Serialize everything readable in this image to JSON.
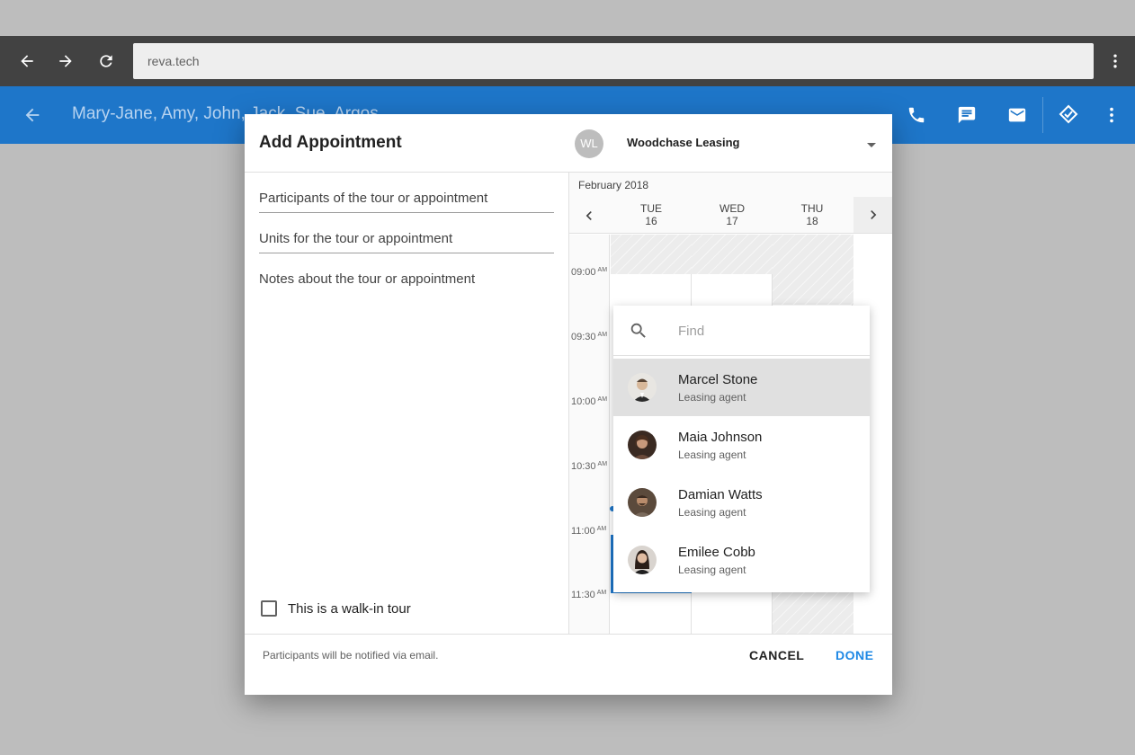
{
  "browser": {
    "url": "reva.tech",
    "icons": [
      "arrow-back-icon",
      "arrow-forward-icon",
      "reload-icon",
      "more-vert-icon"
    ]
  },
  "appbar": {
    "title": "Mary-Jane, Amy, John, Jack, Sue, Argos",
    "icons": [
      "arrow-back-icon",
      "phone-icon",
      "chat-icon",
      "email-icon",
      "flag-icon",
      "more-vert-icon"
    ]
  },
  "dialog": {
    "title": "Add Appointment",
    "owner_initials": "WL",
    "owner_name": "Woodchase Leasing",
    "participants_placeholder": "Participants of the tour or appointment",
    "units_placeholder": "Units for the tour or appointment",
    "notes_placeholder": "Notes about the tour or appointment",
    "walkin_label": "This is a walk-in tour",
    "walkin_checked": false,
    "footnote": "Participants will be notified via email.",
    "cancel_label": "CANCEL",
    "done_label": "DONE"
  },
  "calendar": {
    "month": "February 2018",
    "days": [
      {
        "dow": "TUE",
        "date": "16"
      },
      {
        "dow": "WED",
        "date": "17"
      },
      {
        "dow": "THU",
        "date": "18"
      }
    ],
    "times": [
      {
        "time": "09:00",
        "ampm": "AM"
      },
      {
        "time": "09:30",
        "ampm": "AM"
      },
      {
        "time": "10:00",
        "ampm": "AM"
      },
      {
        "time": "10:30",
        "ampm": "AM"
      },
      {
        "time": "11:00",
        "ampm": "AM"
      },
      {
        "time": "11:30",
        "ampm": "AM"
      }
    ]
  },
  "dropdown": {
    "search_placeholder": "Find",
    "agents": [
      {
        "name": "Marcel Stone",
        "role": "Leasing agent",
        "selected": true
      },
      {
        "name": "Maia Johnson",
        "role": "Leasing agent",
        "selected": false
      },
      {
        "name": "Damian Watts",
        "role": "Leasing agent",
        "selected": false
      },
      {
        "name": "Emilee Cobb",
        "role": "Leasing agent",
        "selected": false
      }
    ]
  },
  "colors": {
    "primary": "#1e76c9",
    "browser_bar": "#424242",
    "backdrop": "#bdbdbd",
    "selected_row": "#e0e0e0"
  }
}
